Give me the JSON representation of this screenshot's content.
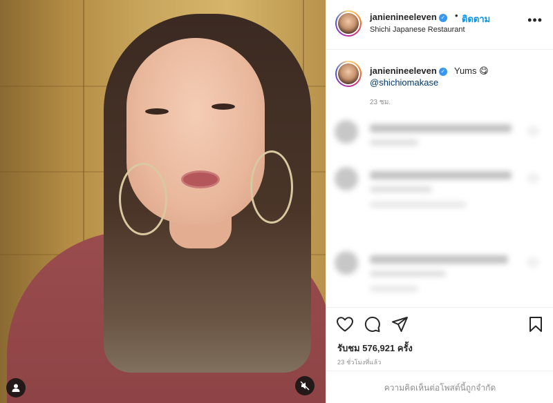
{
  "post": {
    "username": "janienineeleven",
    "verified_glyph": "✓",
    "dot": "•",
    "follow_label": "ติดตาม",
    "location": "Shichi Japanese Restaurant",
    "more_glyph": "•••",
    "caption_text": "Yums 😋",
    "caption_mention": "@shichiomakase",
    "time_ago": "23 ชม.",
    "views_text": "รับชม 576,921 ครั้ง",
    "posted_ago": "23 ชั่วโมงที่แล้ว",
    "comments_limited": "ความคิดเห็นต่อโพสต์นี้ถูกจำกัด"
  },
  "icons": {
    "heart": "heart-icon",
    "comment": "comment-icon",
    "share": "share-icon",
    "save": "bookmark-icon",
    "mute": "muted-speaker-icon",
    "tagged": "user-tag-icon"
  },
  "colors": {
    "link": "#0095f6",
    "mention": "#00376b",
    "muted_text": "#8e8e8e",
    "text": "#262626"
  }
}
